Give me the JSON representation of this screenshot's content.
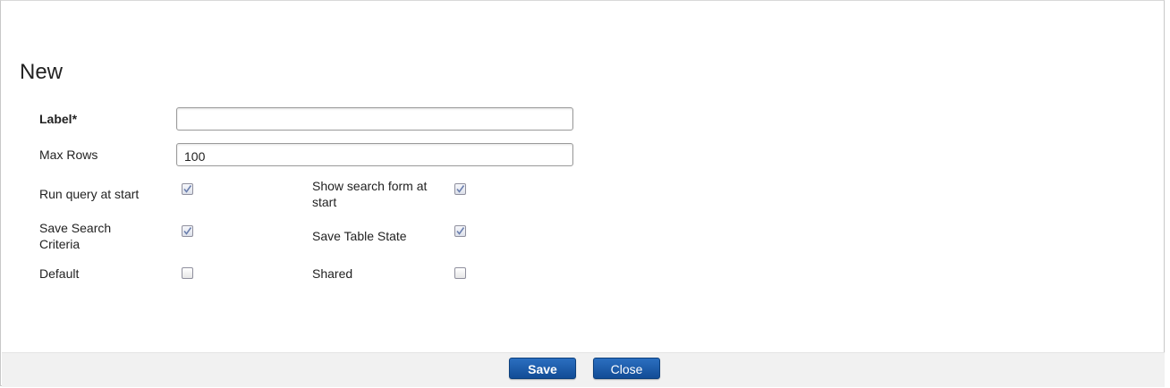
{
  "dialog": {
    "title": "New"
  },
  "form": {
    "label": {
      "text": "Label",
      "required_marker": "*",
      "value": ""
    },
    "max_rows": {
      "text": "Max Rows",
      "value": "100"
    },
    "run_query_at_start": {
      "text": "Run query at start",
      "checked": true
    },
    "show_search_form_at_start": {
      "text": "Show search form at start",
      "checked": true
    },
    "save_search_criteria": {
      "text": "Save Search Criteria",
      "checked": true
    },
    "save_table_state": {
      "text": "Save Table State",
      "checked": true
    },
    "default": {
      "text": "Default",
      "checked": false
    },
    "shared": {
      "text": "Shared",
      "checked": false
    }
  },
  "footer": {
    "save_label": "Save",
    "close_label": "Close"
  },
  "colors": {
    "button_primary": "#1a5aa8",
    "footer_bg": "#f1f1f1",
    "checkmark": "#6b7fae"
  }
}
